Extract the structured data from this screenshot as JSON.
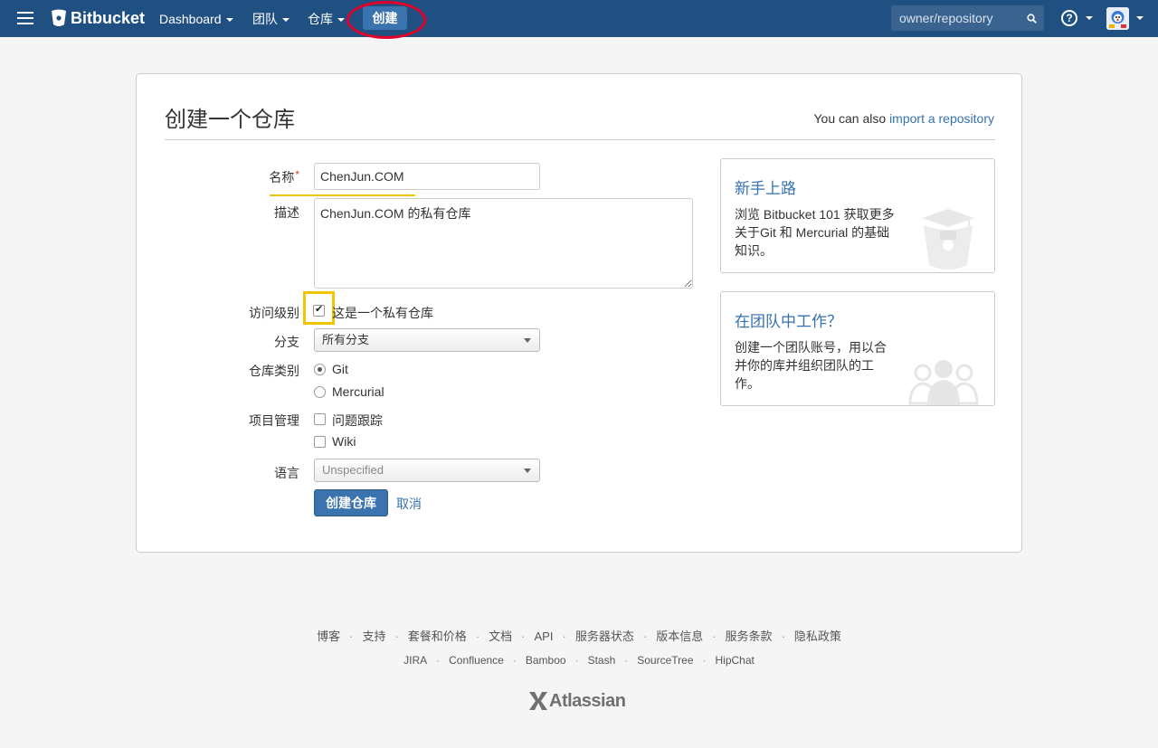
{
  "topbar": {
    "brand": "Bitbucket",
    "nav": [
      "Dashboard",
      "团队",
      "仓库"
    ],
    "create_label": "创建",
    "search_placeholder": "owner/repository",
    "help_label": "?"
  },
  "page": {
    "title": "创建一个仓库",
    "import_prefix": "You can also ",
    "import_link": "import a repository"
  },
  "form": {
    "name_label": "名称",
    "name_required": "*",
    "name_value": "ChenJun.COM",
    "description_label": "描述",
    "description_value": "ChenJun.COM 的私有仓库",
    "access_label": "访问级别",
    "private_label": "这是一个私有仓库",
    "private_checked": true,
    "branch_label": "分支",
    "branch_value": "所有分支",
    "type_label": "仓库类别",
    "type_git": "Git",
    "type_mercurial": "Mercurial",
    "project_label": "项目管理",
    "issue_tracker": "问题跟踪",
    "wiki": "Wiki",
    "language_label": "语言",
    "language_value": "Unspecified",
    "submit_label": "创建仓库",
    "cancel_label": "取消"
  },
  "side": {
    "card1_title": "新手上路",
    "card1_text": "浏览 Bitbucket 101 获取更多关于Git 和 Mercurial 的基础知识。",
    "card2_title": "在团队中工作？",
    "card2_text": "创建一个团队账号，用以合并你的库并组织团队的工作。"
  },
  "footer": {
    "row1": [
      "博客",
      "支持",
      "套餐和价格",
      "文档",
      "API",
      "服务器状态",
      "版本信息",
      "服务条款",
      "隐私政策"
    ],
    "row2": [
      "JIRA",
      "Confluence",
      "Bamboo",
      "Stash",
      "SourceTree",
      "HipChat"
    ],
    "brand": "Atlassian"
  },
  "colors": {
    "topbar": "#205081",
    "primary": "#3b73af",
    "link": "#3572b0",
    "highlight_yellow": "#f5c400",
    "highlight_red": "#e4002b"
  }
}
